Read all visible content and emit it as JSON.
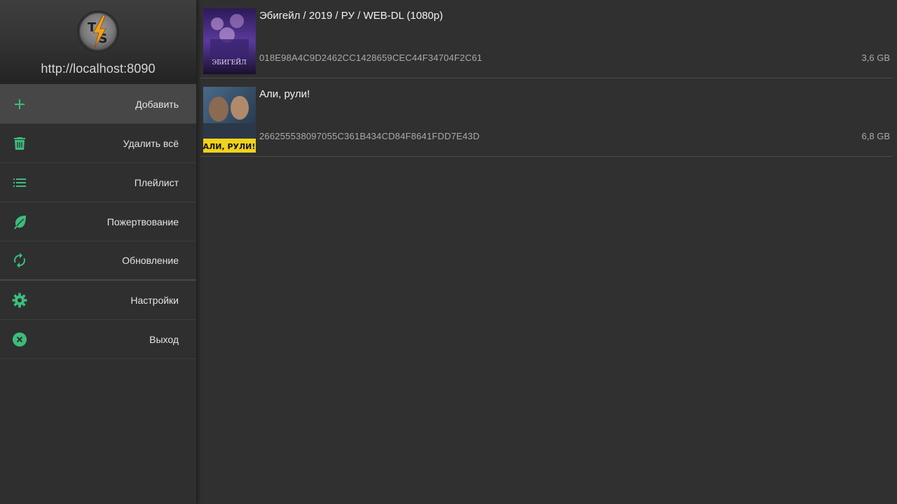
{
  "header": {
    "logo_letters": [
      "T",
      "S"
    ],
    "server_url": "http://localhost:8090"
  },
  "menu": {
    "items": [
      {
        "id": "add",
        "label": "Добавить",
        "icon": "plus-icon"
      },
      {
        "id": "remove-all",
        "label": "Удалить всё",
        "icon": "trash-icon"
      },
      {
        "id": "playlist",
        "label": "Плейлист",
        "icon": "list-icon"
      },
      {
        "id": "donate",
        "label": "Пожертвование",
        "icon": "leaf-icon"
      },
      {
        "id": "update",
        "label": "Обновление",
        "icon": "refresh-icon"
      },
      {
        "id": "settings",
        "label": "Настройки",
        "icon": "gear-icon"
      },
      {
        "id": "exit",
        "label": "Выход",
        "icon": "close-circle-icon"
      }
    ]
  },
  "torrents": [
    {
      "title": "Эбигейл / 2019 / РУ / WEB-DL (1080p)",
      "hash": "018E98A4C9D2462CC1428659CEC44F34704F2C61",
      "size": "3,6 GB",
      "poster_text": "ЭБИГЕЙЛ"
    },
    {
      "title": "Али, рули!",
      "hash": "266255538097055C361B434CD84F8641FDD7E43D",
      "size": "6,8 GB",
      "poster_text": "АЛИ, РУЛИ!"
    }
  ],
  "colors": {
    "accent": "#3dbd7d",
    "background": "#303030",
    "sidebar": "#2f2f2f",
    "logo_bolt": "#f0a020"
  }
}
